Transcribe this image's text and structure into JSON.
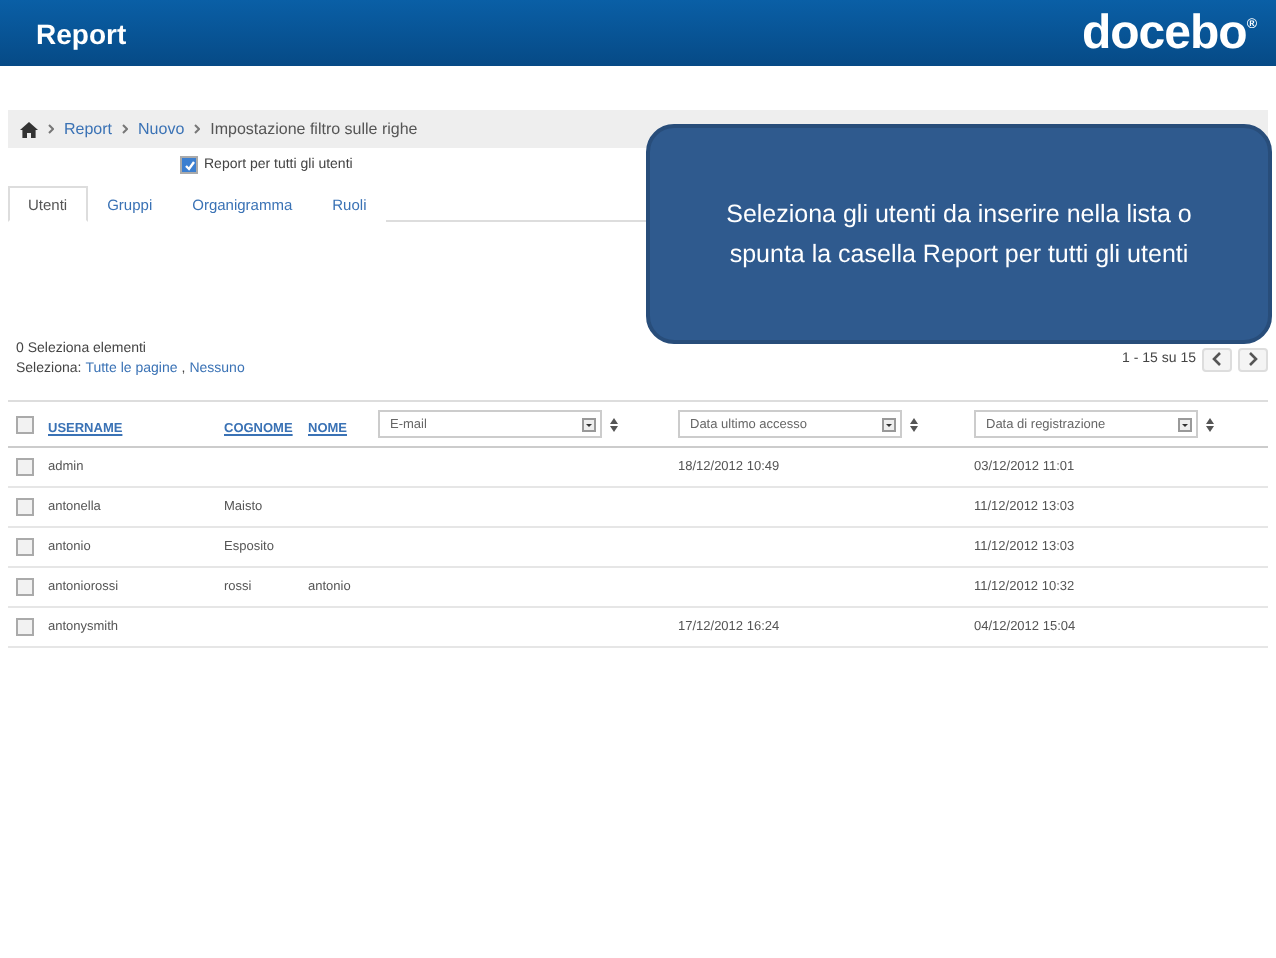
{
  "header": {
    "title": "Report",
    "logo": "docebo",
    "logo_mark": "®"
  },
  "breadcrumb": [
    {
      "label": "Report",
      "kind": "link"
    },
    {
      "label": "Nuovo",
      "kind": "link"
    },
    {
      "label": "Impostazione filtro sulle righe",
      "kind": "current"
    }
  ],
  "all_users_checkbox": {
    "label": "Report per tutti gli utenti",
    "checked": true
  },
  "tabs": [
    {
      "label": "Utenti",
      "selected": true
    },
    {
      "label": "Gruppi",
      "selected": false
    },
    {
      "label": "Organigramma",
      "selected": false
    },
    {
      "label": "Ruoli",
      "selected": false
    }
  ],
  "selection": {
    "count": "0 Seleziona elementi",
    "label": "Seleziona:",
    "links": [
      "Tutte le pagine",
      "Nessuno"
    ],
    "separator": ","
  },
  "pagination": {
    "range": "1 - 15 su 15"
  },
  "table": {
    "all_checked": false,
    "columns": [
      {
        "label": "USERNAME",
        "kind": "sort"
      },
      {
        "label": "COGNOME",
        "kind": "sort"
      },
      {
        "label": "NOME",
        "kind": "sort"
      },
      {
        "label": "E-mail",
        "kind": "select"
      },
      {
        "label": "Data ultimo accesso",
        "kind": "select"
      },
      {
        "label": "Data di registrazione",
        "kind": "select"
      }
    ],
    "rows": [
      {
        "checked": false,
        "cells": [
          "admin",
          "",
          "",
          "",
          "18/12/2012 10:49",
          "03/12/2012 11:01"
        ]
      },
      {
        "checked": false,
        "cells": [
          "antonella",
          "Maisto",
          "",
          "",
          "",
          "11/12/2012 13:03"
        ]
      },
      {
        "checked": false,
        "cells": [
          "antonio",
          "Esposito",
          "",
          "",
          "",
          "11/12/2012 13:03"
        ]
      },
      {
        "checked": false,
        "cells": [
          "antoniorossi",
          "rossi",
          "antonio",
          "",
          "",
          "11/12/2012 10:32"
        ]
      },
      {
        "checked": false,
        "cells": [
          "antonysmith",
          "",
          "",
          "",
          "17/12/2012 16:24",
          "04/12/2012 15:04"
        ]
      }
    ]
  },
  "callout": {
    "text": "Seleziona gli utenti da inserire nella lista o spunta la casella Report per tutti gli utenti"
  }
}
